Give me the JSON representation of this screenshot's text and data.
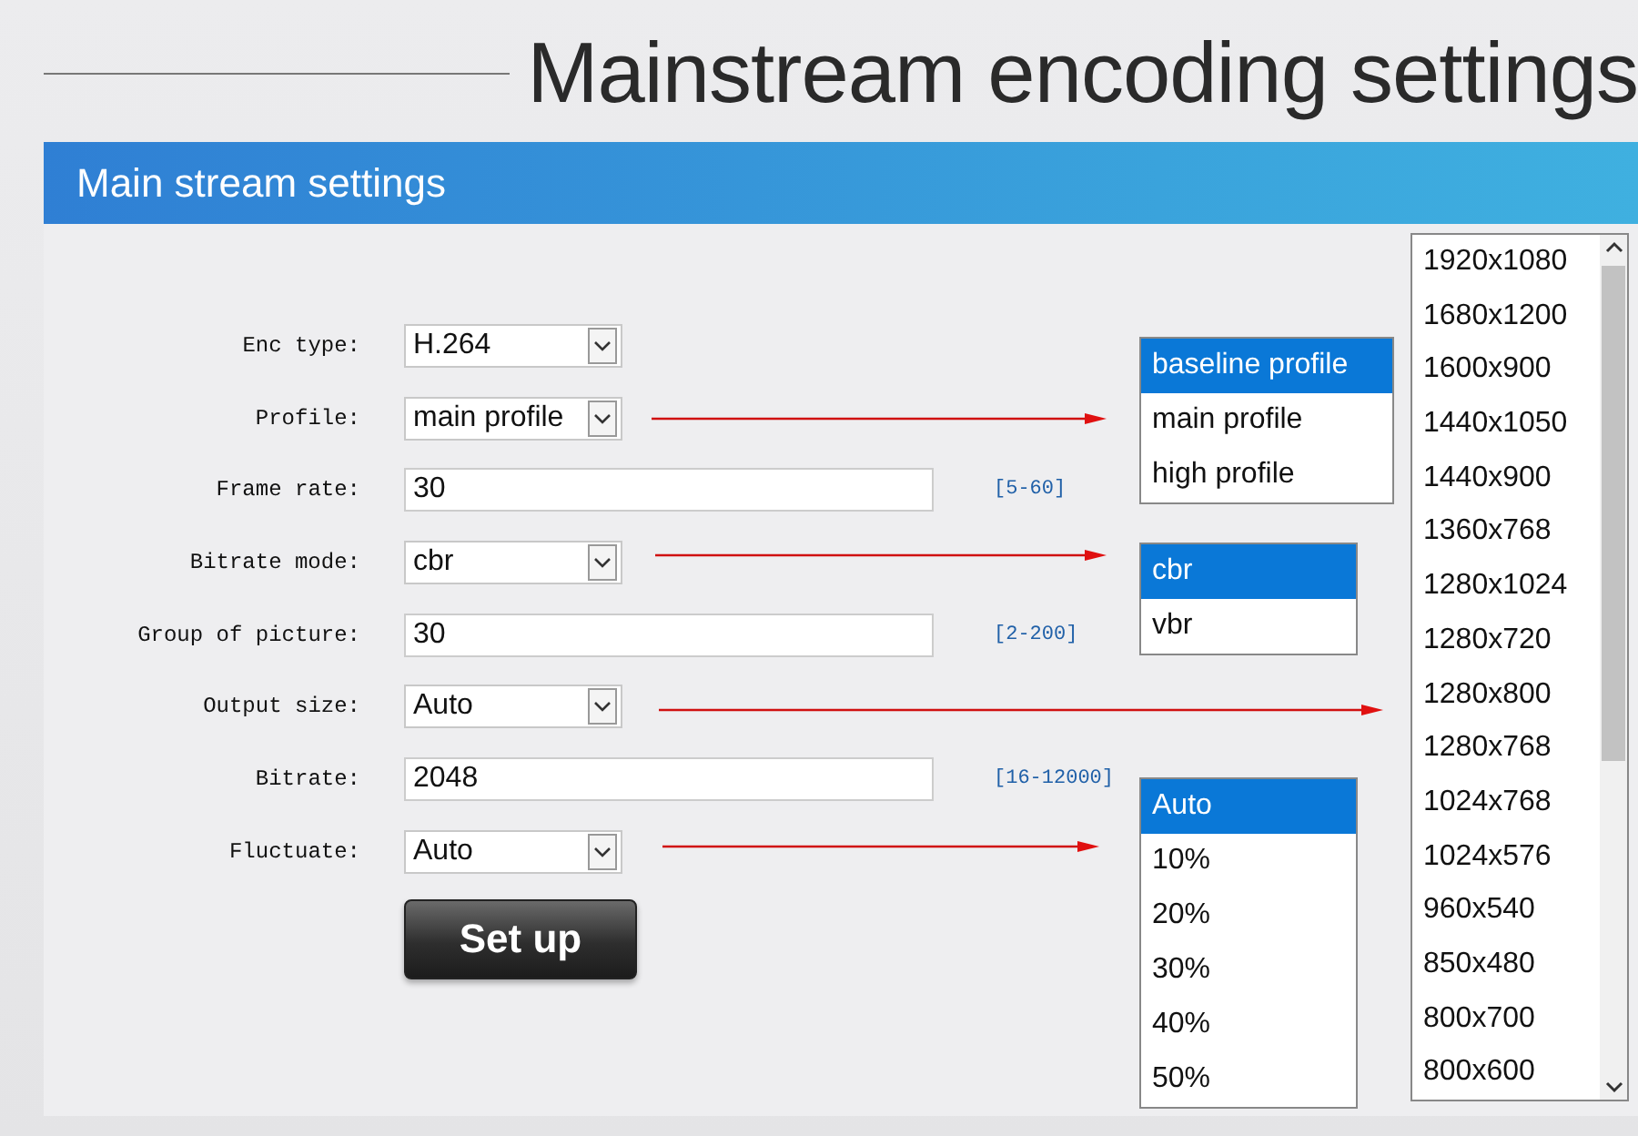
{
  "page_title": "Mainstream encoding settings",
  "panel_title": "Main stream settings",
  "fields": [
    {
      "label": "Enc type:",
      "kind": "select",
      "value": "H.264"
    },
    {
      "label": "Profile:",
      "kind": "select",
      "value": "main profile"
    },
    {
      "label": "Frame rate:",
      "kind": "input",
      "value": "30",
      "range": "[5-60]"
    },
    {
      "label": "Bitrate mode:",
      "kind": "select",
      "value": "cbr"
    },
    {
      "label": "Group of picture:",
      "kind": "input",
      "value": "30",
      "range": "[2-200]"
    },
    {
      "label": "Output size:",
      "kind": "select",
      "value": "Auto"
    },
    {
      "label": "Bitrate:",
      "kind": "input",
      "value": "2048",
      "range": "[16-12000]"
    },
    {
      "label": "Fluctuate:",
      "kind": "select",
      "value": "Auto"
    }
  ],
  "button": "Set up",
  "dropdowns": [
    {
      "items": [
        {
          "label": "baseline profile",
          "selected": true
        },
        {
          "label": "main profile",
          "selected": false
        },
        {
          "label": "high profile",
          "selected": false
        }
      ]
    },
    {
      "items": [
        {
          "label": "cbr",
          "selected": true
        },
        {
          "label": "vbr",
          "selected": false
        }
      ]
    },
    {
      "items": [
        {
          "label": "Auto",
          "selected": true
        },
        {
          "label": "10%",
          "selected": false
        },
        {
          "label": "20%",
          "selected": false
        },
        {
          "label": "30%",
          "selected": false
        },
        {
          "label": "40%",
          "selected": false
        },
        {
          "label": "50%",
          "selected": false
        }
      ]
    },
    {
      "items": [
        {
          "label": "1920x1080",
          "selected": false
        },
        {
          "label": "1680x1200",
          "selected": false
        },
        {
          "label": "1600x900",
          "selected": false
        },
        {
          "label": "1440x1050",
          "selected": false
        },
        {
          "label": "1440x900",
          "selected": false
        },
        {
          "label": "1360x768",
          "selected": false
        },
        {
          "label": "1280x1024",
          "selected": false
        },
        {
          "label": "1280x720",
          "selected": false
        },
        {
          "label": "1280x800",
          "selected": false
        },
        {
          "label": "1280x768",
          "selected": false
        },
        {
          "label": "1024x768",
          "selected": false
        },
        {
          "label": "1024x576",
          "selected": false
        },
        {
          "label": "960x540",
          "selected": false
        },
        {
          "label": "850x480",
          "selected": false
        },
        {
          "label": "800x700",
          "selected": false
        },
        {
          "label": "800x600",
          "selected": false
        }
      ]
    }
  ]
}
